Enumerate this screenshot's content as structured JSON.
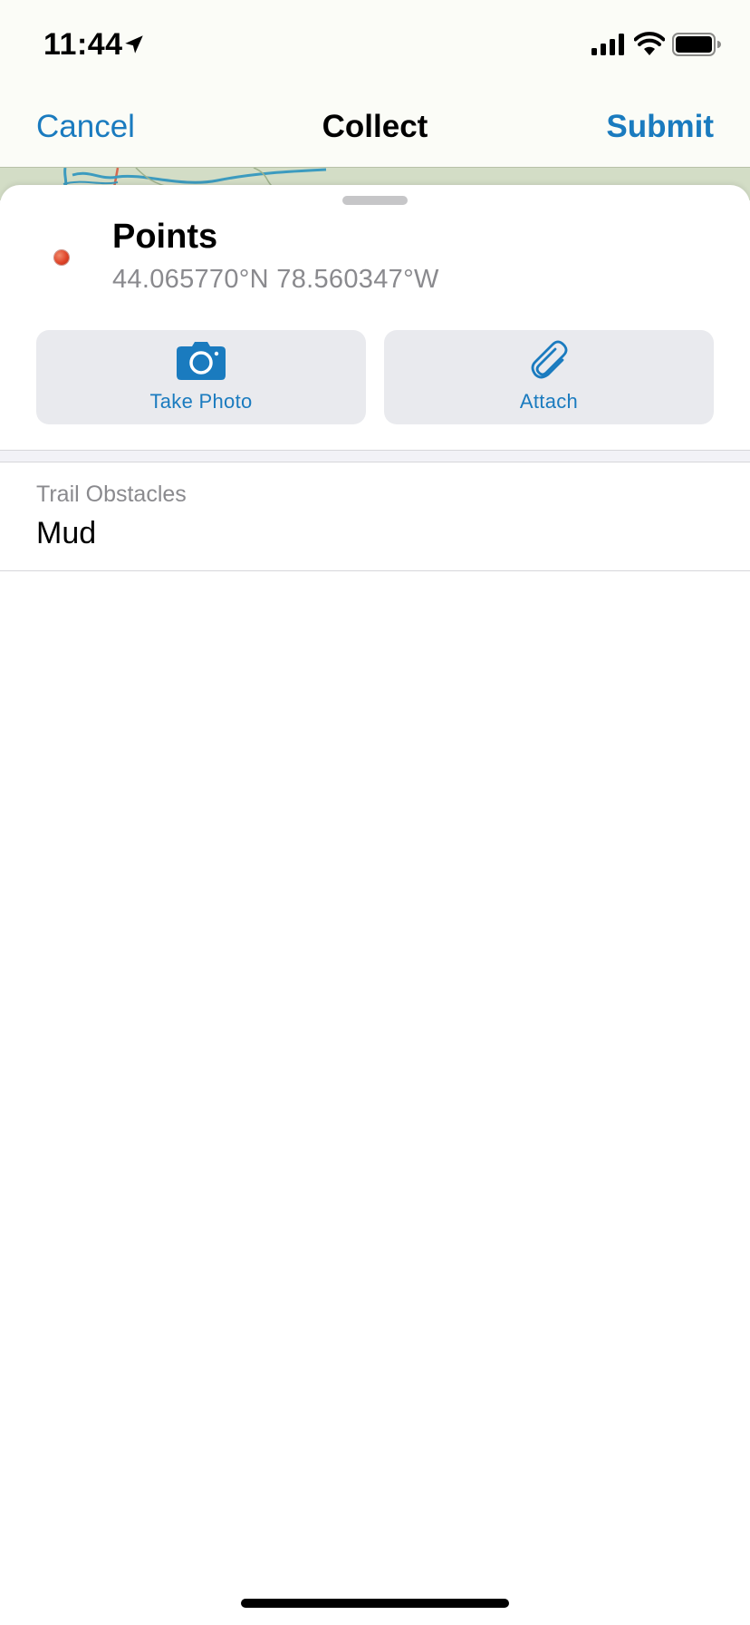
{
  "status_bar": {
    "time": "11:44",
    "icons": [
      "location-arrow-icon",
      "cellular-signal-icon",
      "wifi-icon",
      "battery-icon"
    ]
  },
  "nav": {
    "cancel_label": "Cancel",
    "title": "Collect",
    "submit_label": "Submit"
  },
  "feature": {
    "title": "Points",
    "coordinates": "44.065770°N  78.560347°W",
    "marker_color": "#e0452a"
  },
  "actions": {
    "take_photo_label": "Take Photo",
    "attach_label": "Attach",
    "icons": [
      "camera-icon",
      "paperclip-icon"
    ]
  },
  "fields": [
    {
      "label": "Trail Obstacles",
      "value": "Mud"
    }
  ],
  "colors": {
    "accent": "#1a7bbf",
    "secondary_text": "#8a8a8e",
    "button_bg": "#e9eaee"
  }
}
